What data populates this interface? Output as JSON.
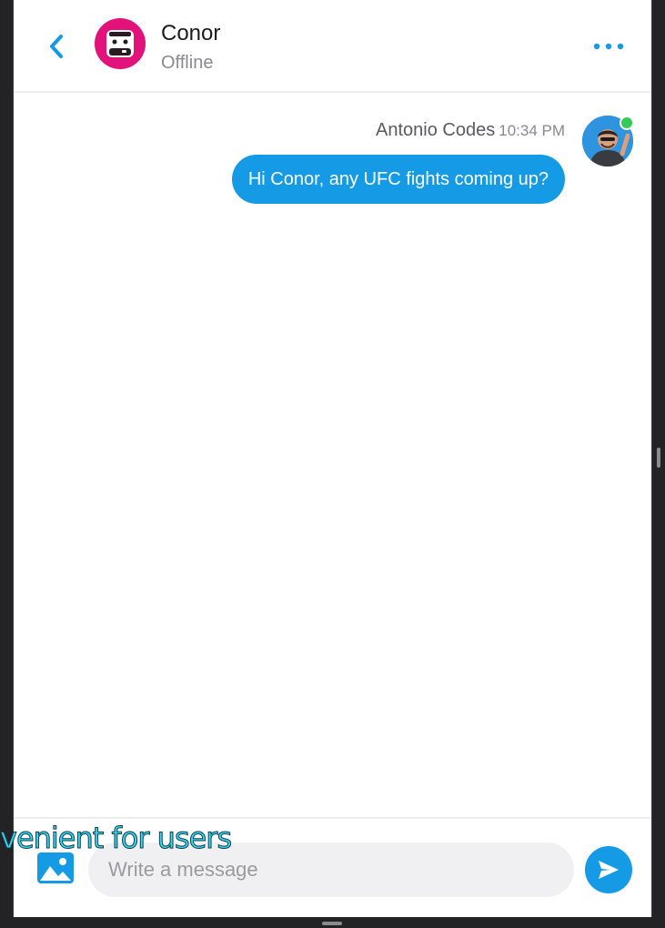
{
  "header": {
    "back_icon": "chevron-left-icon",
    "contact_name": "Conor",
    "contact_status": "Offline",
    "more_icon": "more-horizontal-icon"
  },
  "messages": [
    {
      "sender": "Antonio Codes",
      "time": "10:34 PM",
      "text": "Hi Conor, any UFC fights coming up?",
      "online": true
    }
  ],
  "composer": {
    "placeholder": "Write a message",
    "image_icon": "image-icon",
    "send_icon": "send-icon"
  },
  "overlay_caption": "venient for users",
  "colors": {
    "accent": "#159be5",
    "contact_avatar_bg": "#e2127a",
    "online": "#35c95a"
  }
}
